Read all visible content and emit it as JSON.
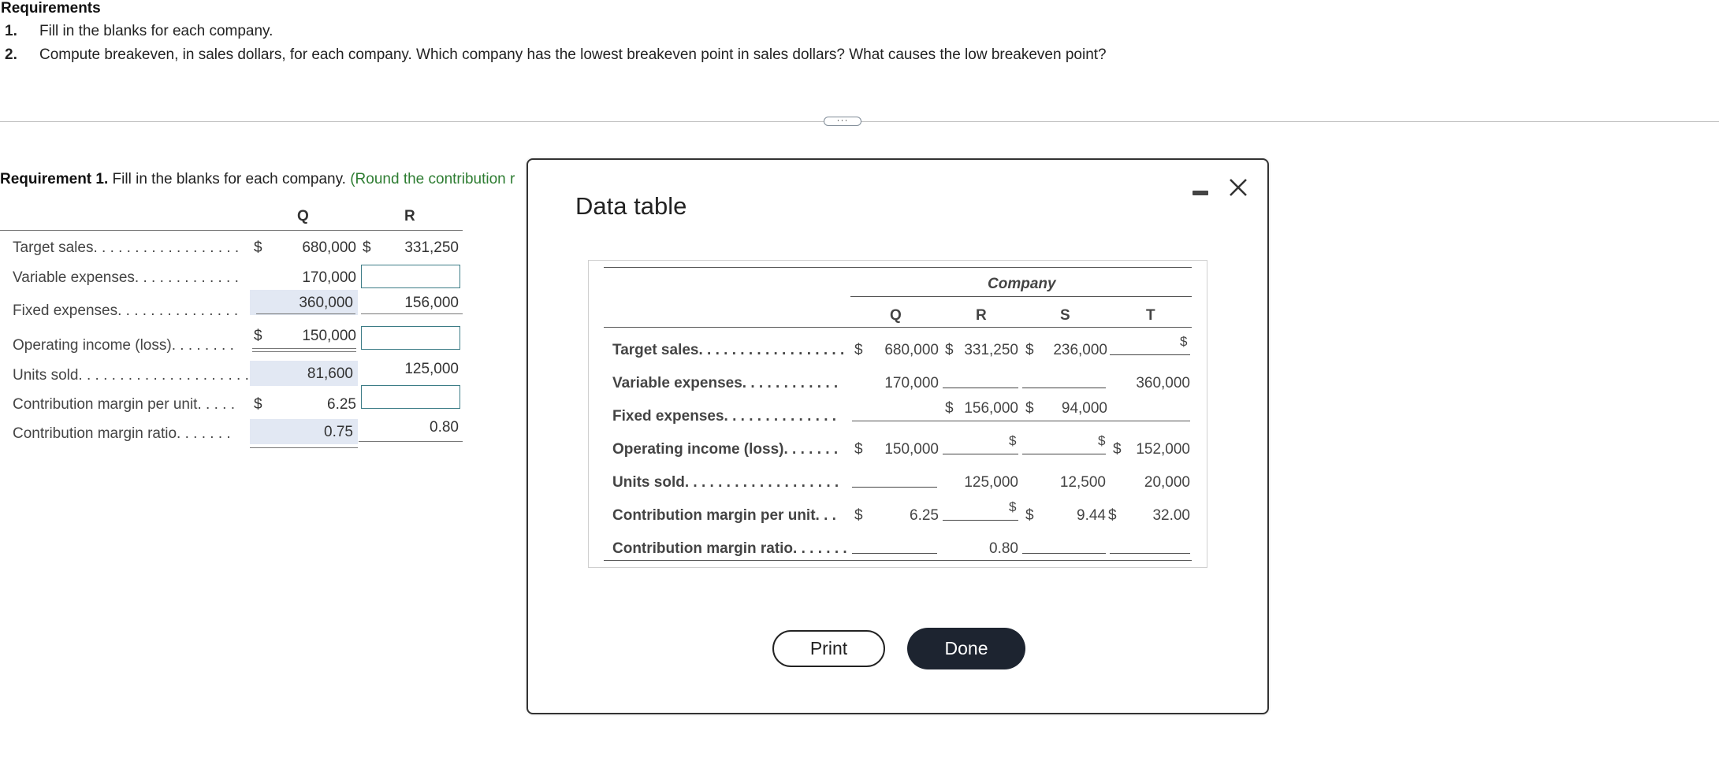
{
  "requirements": {
    "title": "Requirements",
    "items": [
      {
        "num": "1.",
        "text": "Fill in the blanks for each company."
      },
      {
        "num": "2.",
        "text": "Compute breakeven, in sales dollars, for each company. Which company has the lowest breakeven point in sales dollars? What causes the low breakeven point?"
      }
    ],
    "more_label": "···"
  },
  "requirement1": {
    "label_bold": "Requirement 1.",
    "label_text": "Fill in the blanks for each company.",
    "label_green": "(Round the contribution r",
    "columns": [
      "Q",
      "R"
    ],
    "rows": [
      {
        "label": "Target sales",
        "dots": ". . . . . . . . . . . . . . . . . .",
        "q": "680,000",
        "r": "331,250"
      },
      {
        "label": "Variable expenses",
        "dots": ". . . . . . . . . . . . .",
        "q": "170,000",
        "r": ""
      },
      {
        "label": "Fixed expenses",
        "dots": ". . . . . . . . . . . . . . .",
        "q": "360,000",
        "r": "156,000"
      },
      {
        "label": "Operating income (loss)",
        "dots": ". . . . . . . .",
        "q": "150,000",
        "r": ""
      },
      {
        "label": "Units sold",
        "dots": ". . . . . . . . . . . . . . . . . . . . .",
        "q": "81,600",
        "r": "125,000"
      },
      {
        "label": "Contribution margin per unit",
        "dots": ". . . . .",
        "q": "6.25",
        "r": ""
      },
      {
        "label": "Contribution margin ratio",
        "dots": ". . . . . . .",
        "q": "0.75",
        "r": "0.80"
      }
    ],
    "dollar_sign": "$"
  },
  "modal": {
    "title": "Data table",
    "group_header": "Company",
    "columns": [
      "Q",
      "R",
      "S",
      "T"
    ],
    "rows": [
      {
        "label": "Target sales",
        "dots": ". . . . . . . . . . . . . . . . . .",
        "q": "680,000",
        "r": "331,250",
        "s": "236,000",
        "t": ""
      },
      {
        "label": "Variable expenses",
        "dots": ". . . . . . . . . . . .",
        "q": "170,000",
        "r": "",
        "s": "",
        "t": "360,000"
      },
      {
        "label": "Fixed expenses",
        "dots": ". . . . . . . . . . . . . .",
        "q": "",
        "r": "156,000",
        "s": "94,000",
        "t": ""
      },
      {
        "label": "Operating income (loss)",
        "dots": ". . . . . . .",
        "q": "150,000",
        "r": "",
        "s": "",
        "t": "152,000"
      },
      {
        "label": "Units sold",
        "dots": ". . . . . . . . . . . . . . . . . . .",
        "q": "",
        "r": "125,000",
        "s": "12,500",
        "t": "20,000"
      },
      {
        "label": "Contribution margin per unit",
        "dots": ". . .",
        "q": "6.25",
        "r": "",
        "s": "9.44",
        "t": "32.00"
      },
      {
        "label": "Contribution margin ratio",
        "dots": ". . . . . . .",
        "q": "",
        "r": "0.80",
        "s": "",
        "t": ""
      }
    ],
    "dollar_sign": "$",
    "print_label": "Print",
    "done_label": "Done"
  }
}
